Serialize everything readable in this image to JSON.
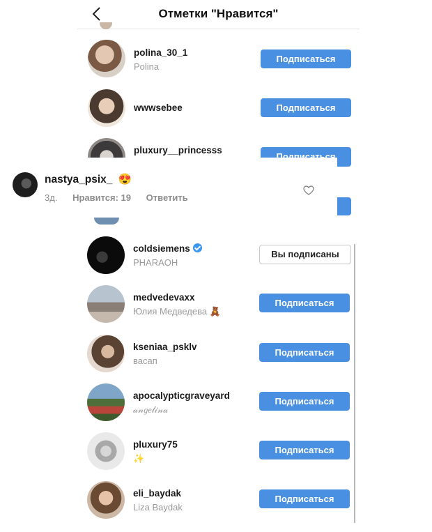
{
  "header": {
    "title": "Отметки \"Нравится\""
  },
  "top_users": [
    {
      "username": "polina_30_1",
      "subtitle": "Polina",
      "button": "Подписаться"
    },
    {
      "username": "wwwsebee",
      "subtitle": "",
      "button": "Подписаться"
    },
    {
      "username": "pluxury__princesss",
      "subtitle": "",
      "button": "Подписаться"
    }
  ],
  "comment": {
    "username": "nastya_psix_",
    "emoji": "😍",
    "time": "3д.",
    "likes": "Нравится: 19",
    "reply": "Ответить"
  },
  "bottom_users": [
    {
      "username": "coldsiemens",
      "subtitle": "PHARAOH",
      "button": "Вы подписаны",
      "verified": true
    },
    {
      "username": "medvedevaxx",
      "subtitle": "Юлия Медведева 🧸",
      "button": "Подписаться"
    },
    {
      "username": "kseniaa_psklv",
      "subtitle": "васап",
      "button": "Подписаться"
    },
    {
      "username": "apocalypticgraveyard",
      "subtitle": "𝒶𝓃𝑔𝑒𝓁𝒾𝓃𝒶",
      "button": "Подписаться"
    },
    {
      "username": "pluxury75",
      "subtitle": "✨",
      "button": "Подписаться"
    },
    {
      "username": "eli_baydak",
      "subtitle": "Liza Baydak",
      "button": "Подписаться"
    }
  ],
  "colors": {
    "accent": "#4a90e2",
    "verified": "#3897f0"
  },
  "icons": {
    "back": "chevron-left-icon",
    "like": "heart-icon",
    "verified": "verified-badge-icon"
  }
}
